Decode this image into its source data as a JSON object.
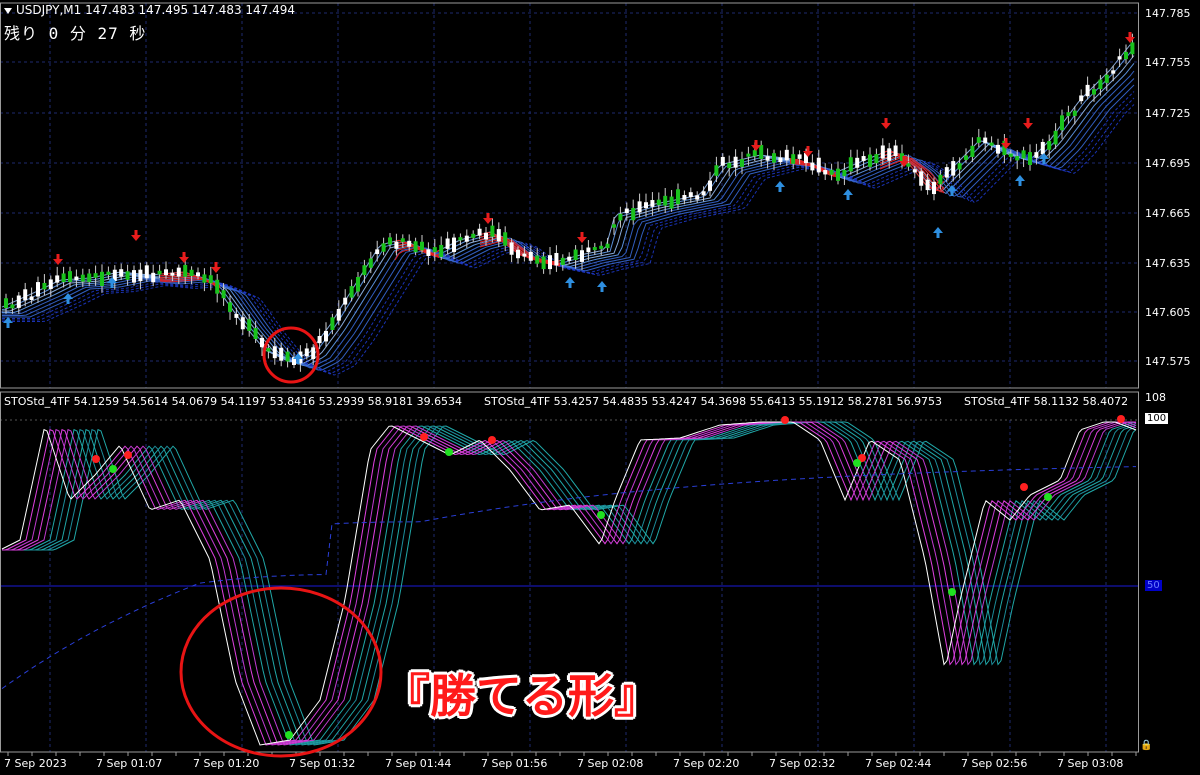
{
  "header": {
    "symbol_line": "USDJPY,M1  147.483 147.495 147.483 147.494",
    "countdown": "残り 0 分 27 秒"
  },
  "price_axis": [
    "147.785",
    "147.755",
    "147.725",
    "147.695",
    "147.665",
    "147.635",
    "147.605",
    "147.575"
  ],
  "indicator": {
    "labels": [
      "STOStd_4TF 54.1259 54.5614 54.0679 54.1197 53.8416 53.2939 58.9181 39.6534",
      "STOStd_4TF 53.4257 54.4835 53.4247 54.3698 55.6413 55.1912 58.2781 56.9753",
      "STOStd_4TF 58.1132 58.4072"
    ],
    "level_top": "108",
    "level_100": "100",
    "level_50": "50"
  },
  "time_axis": [
    "7 Sep 2023",
    "7 Sep 01:07",
    "7 Sep 01:20",
    "7 Sep 01:32",
    "7 Sep 01:44",
    "7 Sep 01:56",
    "7 Sep 02:08",
    "7 Sep 02:20",
    "7 Sep 02:32",
    "7 Sep 02:44",
    "7 Sep 02:56",
    "7 Sep 03:08"
  ],
  "annotation": {
    "caption": "『勝てる形』"
  },
  "colors": {
    "background": "#000000",
    "grid": "#1e2a6e",
    "bull_candle": "#19c21c",
    "bear_candle": "#ffffff",
    "sell_arrow": "#e81c1c",
    "buy_arrow": "#2e8fe0",
    "highlight_circle": "#e81414",
    "level_line": "#1a1ad8"
  },
  "icons": [
    "sell-arrow-icon",
    "buy-arrow-icon",
    "signal-dot-icon",
    "dropdown-triangle-icon",
    "lock-icon"
  ]
}
